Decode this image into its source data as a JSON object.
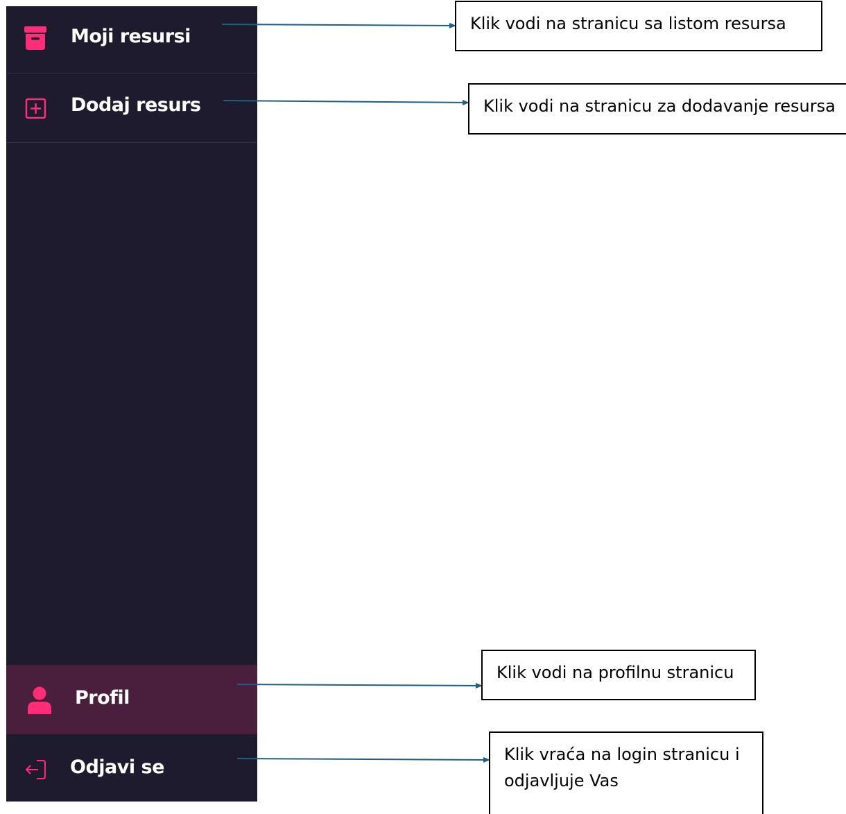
{
  "sidebar": {
    "items": [
      {
        "label": "Moji resursi",
        "icon": "archive-box-icon"
      },
      {
        "label": "Dodaj resurs",
        "icon": "plus-square-icon"
      },
      {
        "label": "Profil",
        "icon": "user-icon",
        "active": true
      },
      {
        "label": "Odjavi se",
        "icon": "logout-icon"
      }
    ]
  },
  "annotations": [
    {
      "text": "Klik vodi na stranicu sa listom resursa"
    },
    {
      "text": "Klik vodi na stranicu za dodavanje resursa"
    },
    {
      "text": "Klik vodi na profilnu stranicu"
    },
    {
      "text": "Klik vraća na login stranicu i odjavljuje Vas"
    }
  ],
  "colors": {
    "sidebar_bg": "#1e1b2e",
    "active_bg": "#4a1f3d",
    "accent": "#ff2d78",
    "arrow": "#1f5f86",
    "label": "#ffffff"
  }
}
